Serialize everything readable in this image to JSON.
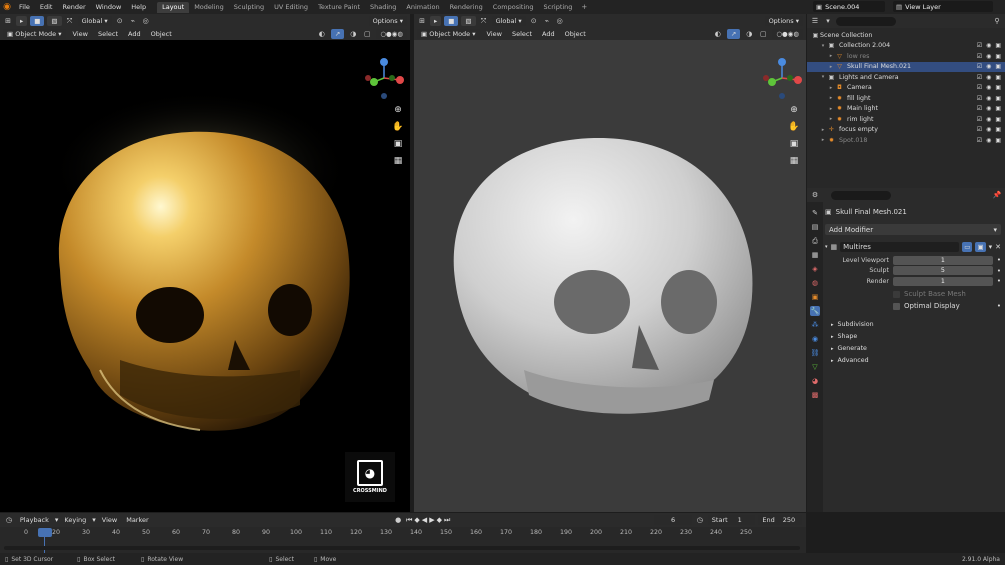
{
  "topbar": {
    "menu": [
      "File",
      "Edit",
      "Render",
      "Window",
      "Help"
    ],
    "workspaces": [
      "Layout",
      "Modeling",
      "Sculpting",
      "UV Editing",
      "Texture Paint",
      "Shading",
      "Animation",
      "Rendering",
      "Compositing",
      "Scripting"
    ],
    "active_workspace": "Layout",
    "scene": "Scene.004",
    "view_layer": "View Layer"
  },
  "viewport_left": {
    "transform": "Global",
    "mode": "Object Mode",
    "menus": [
      "View",
      "Select",
      "Add",
      "Object"
    ],
    "options": "Options",
    "watermark": "CROSSMIND"
  },
  "viewport_right": {
    "transform": "Global",
    "mode": "Object Mode",
    "menus": [
      "View",
      "Select",
      "Add",
      "Object"
    ],
    "options": "Options"
  },
  "outliner": {
    "root": "Scene Collection",
    "items": [
      {
        "label": "Collection 2.004",
        "indent": 1,
        "icon": "collection-icon",
        "color": "#ccc",
        "selected": false
      },
      {
        "label": "low res",
        "indent": 2,
        "icon": "mesh-icon",
        "color": "#e58b2a",
        "selected": false,
        "dim": true
      },
      {
        "label": "Skull Final Mesh.021",
        "indent": 2,
        "icon": "mesh-icon",
        "color": "#e58b2a",
        "selected": true
      },
      {
        "label": "Lights and Camera",
        "indent": 1,
        "icon": "collection-icon",
        "color": "#ccc",
        "selected": false
      },
      {
        "label": "Camera",
        "indent": 2,
        "icon": "camera-icon",
        "color": "#e58b2a",
        "selected": false
      },
      {
        "label": "fill light",
        "indent": 2,
        "icon": "light-icon",
        "color": "#e58b2a",
        "selected": false
      },
      {
        "label": "Main light",
        "indent": 2,
        "icon": "light-icon",
        "color": "#e58b2a",
        "selected": false
      },
      {
        "label": "rim light",
        "indent": 2,
        "icon": "light-icon",
        "color": "#e58b2a",
        "selected": false
      },
      {
        "label": "focus empty",
        "indent": 1,
        "icon": "empty-icon",
        "color": "#e58b2a",
        "selected": false
      },
      {
        "label": "Spot.018",
        "indent": 1,
        "icon": "light-icon",
        "color": "#e58b2a",
        "selected": false,
        "dim": true
      }
    ]
  },
  "properties": {
    "object_name": "Skull Final Mesh.021",
    "add_modifier": "Add Modifier",
    "modifier_name": "Multires",
    "fields": [
      {
        "label": "Level Viewport",
        "value": "1"
      },
      {
        "label": "Sculpt",
        "value": "5"
      },
      {
        "label": "Render",
        "value": "1"
      }
    ],
    "sculpt_base_mesh": "Sculpt Base Mesh",
    "optimal_display": "Optimal Display",
    "subpanels": [
      "Subdivision",
      "Shape",
      "Generate",
      "Advanced"
    ]
  },
  "timeline": {
    "menus": [
      "Playback",
      "Keying",
      "View",
      "Marker"
    ],
    "current_frame": "6",
    "start_label": "Start",
    "start": "1",
    "end_label": "End",
    "end": "250",
    "ticks": [
      "0",
      "6",
      "20",
      "30",
      "40",
      "50",
      "60",
      "70",
      "80",
      "90",
      "100",
      "110",
      "120",
      "130",
      "140",
      "150",
      "160",
      "170",
      "180",
      "190",
      "200",
      "210",
      "220",
      "230",
      "240",
      "250"
    ]
  },
  "status": {
    "items": [
      "Set 3D Cursor",
      "Box Select",
      "Rotate View",
      "Select",
      "Move"
    ],
    "version": "2.91.0 Alpha"
  }
}
